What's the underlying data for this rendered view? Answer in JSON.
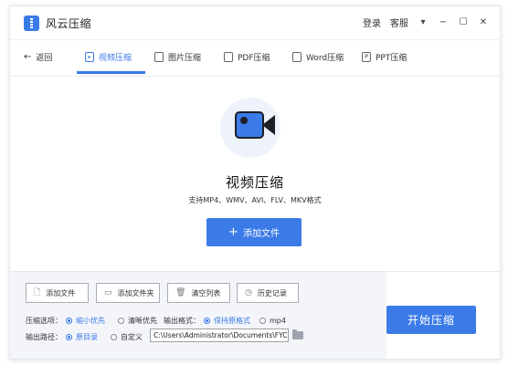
{
  "app": {
    "title": "风云压缩",
    "accent": "#3b7be8"
  },
  "titlebar": {
    "login": "登录",
    "service": "客服",
    "menu_icon": "chevron-down-icon",
    "minimize_icon": "minimize-icon",
    "maximize_icon": "maximize-icon",
    "close_icon": "close-icon"
  },
  "nav": {
    "back_label": "返回",
    "tabs": [
      {
        "label": "视频压缩",
        "icon": "video-icon",
        "active": true
      },
      {
        "label": "图片压缩",
        "icon": "image-icon",
        "active": false
      },
      {
        "label": "PDF压缩",
        "icon": "pdf-icon",
        "active": false
      },
      {
        "label": "Word压缩",
        "icon": "word-icon",
        "active": false
      },
      {
        "label": "PPT压缩",
        "icon": "ppt-icon",
        "active": false
      }
    ]
  },
  "hero": {
    "icon": "video-camera-icon",
    "title": "视频压缩",
    "subtitle": "支持MP4、WMV、AVI、FLV、MKV格式",
    "add_file_label": "添加文件"
  },
  "toolbar": {
    "add_file": "添加文件",
    "add_folder": "添加文件夹",
    "clear_list": "清空列表",
    "history": "历史记录"
  },
  "options": {
    "compress_label": "压缩选项：",
    "compress_options": [
      {
        "label": "缩小优先",
        "selected": true
      },
      {
        "label": "清晰优先",
        "selected": false
      }
    ],
    "format_label": "输出格式：",
    "format_options": [
      {
        "label": "保持原格式",
        "selected": true
      },
      {
        "label": "mp4",
        "selected": false
      }
    ],
    "path_label": "输出路径：",
    "path_options": [
      {
        "label": "原目录",
        "selected": true
      },
      {
        "label": "自定义",
        "selected": false
      }
    ],
    "path_value": "C:\\Users\\Administrator\\Documents\\FYCom"
  },
  "start_button": "开始压缩"
}
